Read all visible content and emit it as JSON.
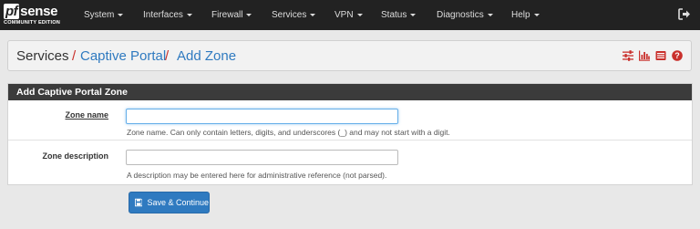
{
  "brand": {
    "logo_pf": "pf",
    "logo_sense": "sense",
    "edition": "COMMUNITY EDITION"
  },
  "nav": {
    "items": [
      {
        "label": "System"
      },
      {
        "label": "Interfaces"
      },
      {
        "label": "Firewall"
      },
      {
        "label": "Services"
      },
      {
        "label": "VPN"
      },
      {
        "label": "Status"
      },
      {
        "label": "Diagnostics"
      },
      {
        "label": "Help"
      }
    ],
    "logout_icon": "sign-out-icon"
  },
  "breadcrumb": {
    "section": "Services",
    "separator": "/",
    "page": "Captive Portal",
    "subpage": "Add Zone",
    "icons": [
      "sliders-icon",
      "bar-chart-icon",
      "list-icon",
      "help-icon"
    ],
    "icon_color": "#c9302c"
  },
  "panel": {
    "title": "Add Captive Portal Zone",
    "zone_name": {
      "label": "Zone name",
      "value": "",
      "help": "Zone name. Can only contain letters, digits, and underscores (_) and may not start with a digit."
    },
    "zone_description": {
      "label": "Zone description",
      "value": "",
      "help": "A description may be entered here for administrative reference (not parsed)."
    }
  },
  "save_button": {
    "label": "Save & Continue",
    "icon": "save-icon"
  },
  "colors": {
    "navbar": "#222222",
    "link": "#2f7ac0",
    "button": "#2f7ac0",
    "panel_head": "#3b3b3b",
    "background": "#e8e8e8"
  }
}
